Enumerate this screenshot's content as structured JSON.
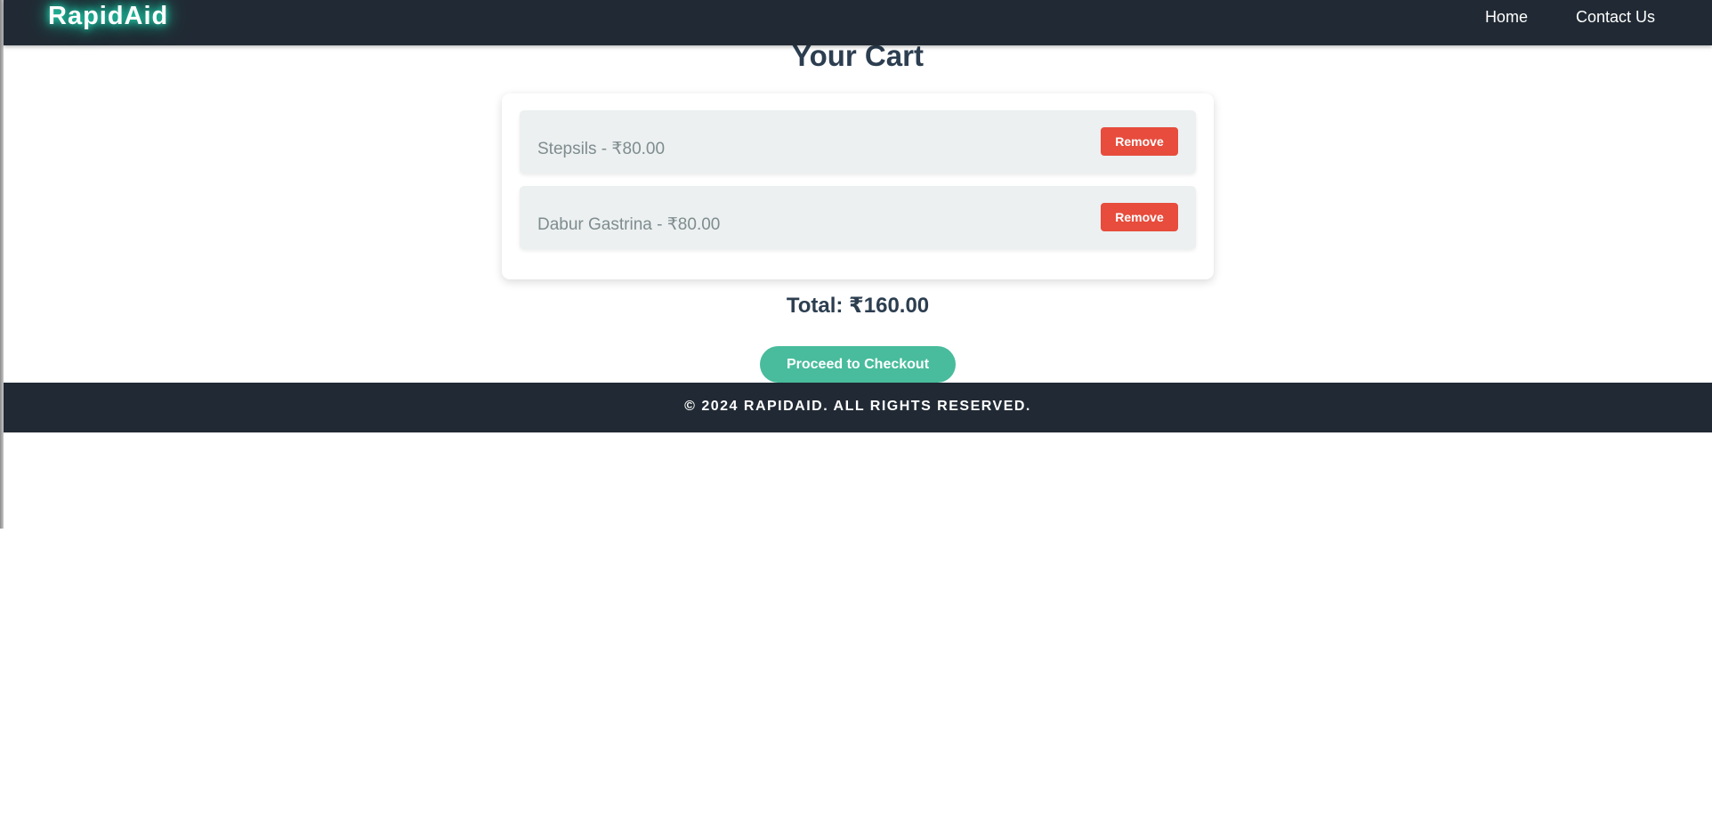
{
  "header": {
    "logo": "RapidAid",
    "nav": [
      {
        "label": "Home"
      },
      {
        "label": "Contact Us"
      }
    ]
  },
  "main": {
    "title": "Your Cart",
    "items": [
      {
        "text": "Stepsils - ₹80.00",
        "remove_label": "Remove"
      },
      {
        "text": "Dabur Gastrina - ₹80.00",
        "remove_label": "Remove"
      }
    ],
    "total": "Total: ₹160.00",
    "checkout_label": "Proceed to Checkout"
  },
  "footer": {
    "text": "© 2024 RapidAid. All rights reserved."
  },
  "colors": {
    "navbar": "#212a34",
    "accent": "#48bc9c",
    "danger": "#e74c3c",
    "heading": "#2c3e50",
    "item_bg": "#ecf0f1"
  }
}
